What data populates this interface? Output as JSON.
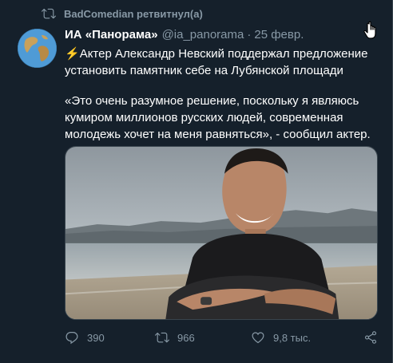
{
  "retweet_context": {
    "text": "BadComedian ретвитнул(а)",
    "icon": "retweet-icon"
  },
  "tweet": {
    "display_name": "ИА «Панорама»",
    "handle": "@ia_panorama",
    "separator": "·",
    "date": "25 февр.",
    "emoji": "⚡",
    "paragraph1": "Актер Александр Невский поддержал предложение установить памятник себе на Лубянской площади",
    "paragraph2": "«Это очень разумное решение, поскольку я являюсь кумиром миллионов русских людей, современная молодежь хочет на меня равняться», - сообщил актер."
  },
  "actions": {
    "reply_count": "390",
    "retweet_count": "966",
    "like_count": "9,8 тыс."
  },
  "colors": {
    "background": "#15202b",
    "text_primary": "#ffffff",
    "text_secondary": "#8899a6",
    "border": "#38444d"
  }
}
